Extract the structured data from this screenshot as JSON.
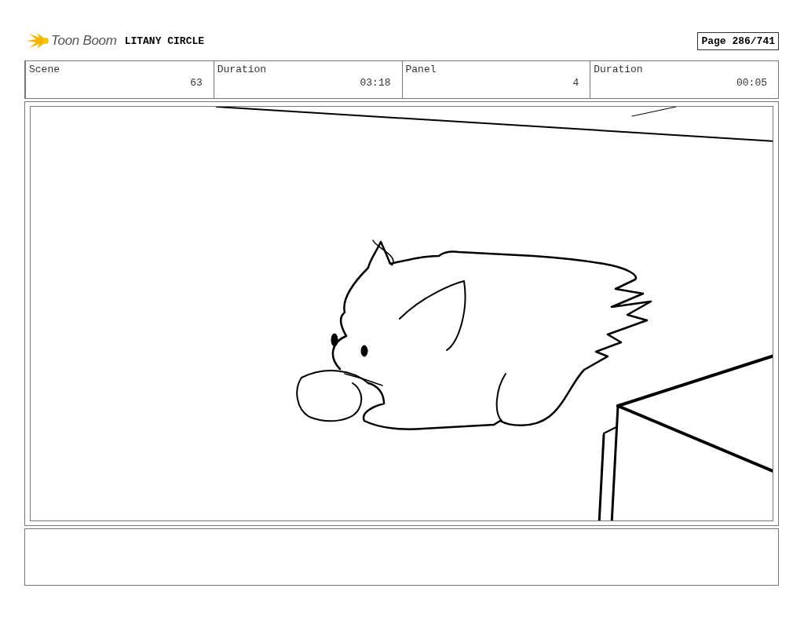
{
  "header": {
    "logo_text": "Toon Boom",
    "project_title": "LITANY CIRCLE",
    "page": "Page 286/741"
  },
  "info": [
    {
      "label": "Scene",
      "value": "63"
    },
    {
      "label": "Duration",
      "value": "03:18"
    },
    {
      "label": "Panel",
      "value": "4"
    },
    {
      "label": "Duration",
      "value": "00:05"
    }
  ],
  "panel": {
    "kind": "sketch"
  }
}
